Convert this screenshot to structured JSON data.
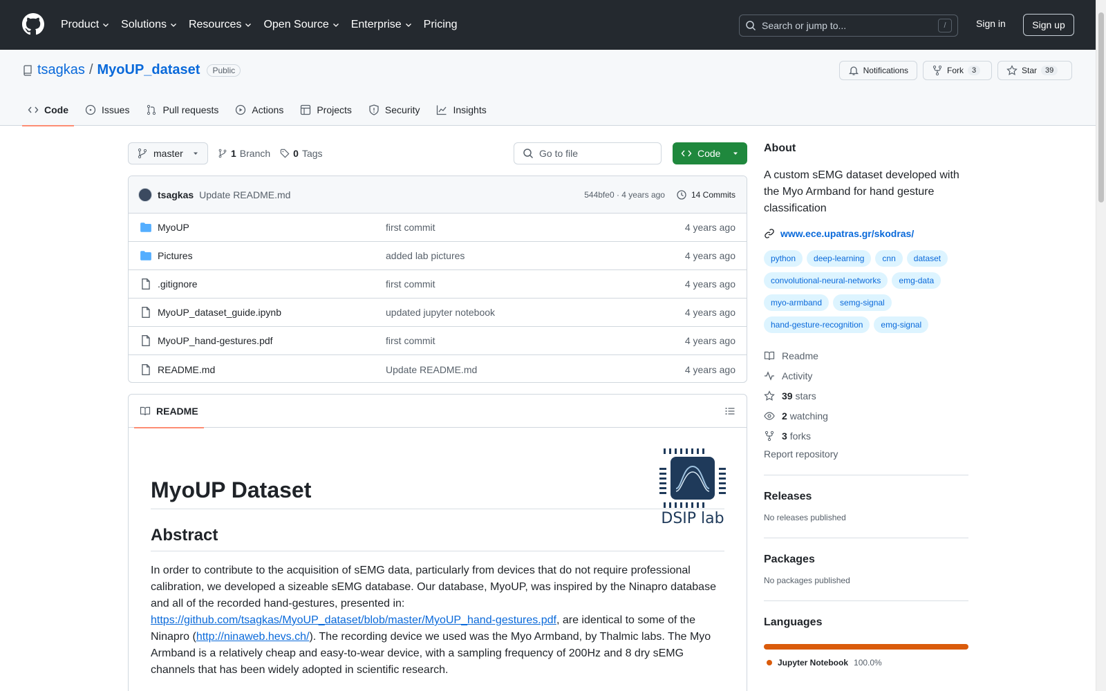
{
  "header": {
    "nav": [
      "Product",
      "Solutions",
      "Resources",
      "Open Source",
      "Enterprise",
      "Pricing"
    ],
    "search_placeholder": "Search or jump to...",
    "search_shortcut": "/",
    "sign_in": "Sign in",
    "sign_up": "Sign up"
  },
  "repo": {
    "owner": "tsagkas",
    "separator": "/",
    "name": "MyoUP_dataset",
    "visibility": "Public",
    "actions": {
      "notifications": "Notifications",
      "fork_label": "Fork",
      "fork_count": "3",
      "star_label": "Star",
      "star_count": "39"
    },
    "tabs": [
      "Code",
      "Issues",
      "Pull requests",
      "Actions",
      "Projects",
      "Security",
      "Insights"
    ]
  },
  "branch_bar": {
    "branch": "master",
    "branch_count": "1",
    "branch_label": "Branch",
    "tag_count": "0",
    "tag_label": "Tags",
    "goto_placeholder": "Go to file",
    "code_button": "Code"
  },
  "latest_commit": {
    "author": "tsagkas",
    "message": "Update README.md",
    "hash_time": "544bfe0 · 4 years ago",
    "commits": "14 Commits"
  },
  "files": [
    {
      "type": "folder",
      "name": "MyoUP",
      "message": "first commit",
      "age": "4 years ago"
    },
    {
      "type": "folder",
      "name": "Pictures",
      "message": "added lab pictures",
      "age": "4 years ago"
    },
    {
      "type": "file",
      "name": ".gitignore",
      "message": "first commit",
      "age": "4 years ago"
    },
    {
      "type": "file",
      "name": "MyoUP_dataset_guide.ipynb",
      "message": "updated jupyter notebook",
      "age": "4 years ago"
    },
    {
      "type": "file",
      "name": "MyoUP_hand-gestures.pdf",
      "message": "first commit",
      "age": "4 years ago"
    },
    {
      "type": "file",
      "name": "README.md",
      "message": "Update README.md",
      "age": "4 years ago"
    }
  ],
  "readme": {
    "tab": "README",
    "logo_text": "DSIP lab",
    "title": "MyoUP Dataset",
    "abstract_heading": "Abstract",
    "p1": "In order to contribute to the acquisition of sEMG data, particularly from devices that do not require professional calibration, we developed a sizeable sEMG database. Our database, MyoUP, was inspired by the Ninapro database and all of the recorded hand-gestures, presented in:",
    "link1": "https://github.com/tsagkas/MyoUP_dataset/blob/master/MyoUP_hand-gestures.pdf",
    "p2": ", are identical to some of the Ninapro (",
    "link2": "http://ninaweb.hevs.ch/",
    "p3": "). The recording device we used was the Myo Armband, by Thalmic labs. The Myo Armband is a relatively cheap and easy-to-wear device, with a sampling frequency of 200Hz and 8 dry sEMG channels that has been widely adopted in scientific research."
  },
  "about": {
    "heading": "About",
    "description": "A custom sEMG dataset developed with the Myo Armband for hand gesture classification",
    "website": "www.ece.upatras.gr/skodras/",
    "topics": [
      "python",
      "deep-learning",
      "cnn",
      "dataset",
      "convolutional-neural-networks",
      "emg-data",
      "myo-armband",
      "semg-signal",
      "hand-gesture-recognition",
      "emg-signal"
    ],
    "readme": "Readme",
    "activity": "Activity",
    "stars_count": "39",
    "stars_label": "stars",
    "watching_count": "2",
    "watching_label": "watching",
    "forks_count": "3",
    "forks_label": "forks",
    "report": "Report repository"
  },
  "releases": {
    "heading": "Releases",
    "text": "No releases published"
  },
  "packages": {
    "heading": "Packages",
    "text": "No packages published"
  },
  "languages": {
    "heading": "Languages",
    "items": [
      {
        "name": "Jupyter Notebook",
        "percent": "100.0%",
        "color": "#DA5B0B"
      }
    ]
  }
}
